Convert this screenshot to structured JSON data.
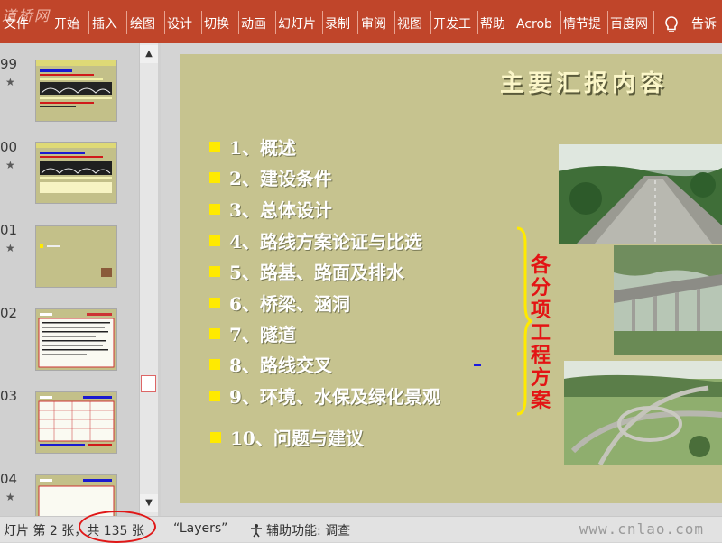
{
  "ribbon": {
    "watermark": "道桥网",
    "tabs": [
      "文件",
      "开始",
      "插入",
      "绘图",
      "设计",
      "切换",
      "动画",
      "幻灯片",
      "录制",
      "审阅",
      "视图",
      "开发工",
      "帮助",
      "Acrob",
      "情节提",
      "百度网"
    ],
    "tell_me": "告诉",
    "colors": {
      "background": "#c0452a",
      "text": "#ffffff"
    }
  },
  "thumbnails": [
    {
      "number": "99",
      "star": "★"
    },
    {
      "number": "00",
      "star": "★"
    },
    {
      "number": "01",
      "star": "★"
    },
    {
      "number": "02",
      "star": ""
    },
    {
      "number": "03",
      "star": ""
    },
    {
      "number": "04",
      "star": "★"
    }
  ],
  "slide": {
    "title": "主要汇报内容",
    "items": [
      "1、概述",
      "2、建设条件",
      "3、总体设计",
      "4、路线方案论证与比选",
      "5、路基、路面及排水",
      "6、桥梁、涵洞",
      "7、隧道",
      "8、路线交叉",
      "9、环境、水保及绿化景观",
      "10、问题与建议"
    ],
    "brace_label": "各分项工程方案",
    "colors": {
      "background": "#c6c38f",
      "bullet": "#ffea00",
      "brace_label": "#e31414"
    }
  },
  "status": {
    "slide_info": "灯片 第 2 张，共 135 张",
    "theme": "“Layers”",
    "accessibility": "辅助功能: 调查",
    "site_watermark": "www.cnlao.com"
  }
}
